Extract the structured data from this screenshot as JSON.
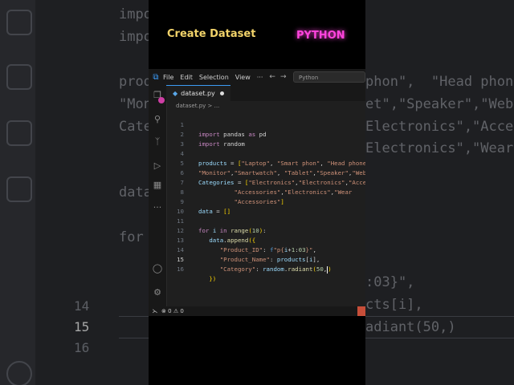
{
  "overlay": {
    "title": "Create Dataset",
    "tag": "PYTHON"
  },
  "menubar": {
    "items": [
      "File",
      "Edit",
      "Selection",
      "View",
      "···"
    ],
    "search_text": "Python"
  },
  "tab": {
    "filename": "dataset.py"
  },
  "breadcrumb": "dataset.py > ...",
  "code": [
    {
      "n": "1",
      "t": "import pandas as pd"
    },
    {
      "n": "2",
      "t": "import random"
    },
    {
      "n": "3",
      "t": ""
    },
    {
      "n": "4",
      "t": "products = [\"Laptop\", \"Smart phon\", \"Head phone"
    },
    {
      "n": "5",
      "t": "\"Monitor\",\"Smartwatch\", \"Tablet\",\"Speaker\",\"Web"
    },
    {
      "n": "6",
      "t": "Categories = [\"Electronics\",\"Electronics\",\"Acce"
    },
    {
      "n": "7",
      "t": "               \"Accessories\",\"Electronics\",\"Wear"
    },
    {
      "n": "8",
      "t": "               \"Accessories\"]"
    },
    {
      "n": "9",
      "t": "data = []"
    },
    {
      "n": "10",
      "t": ""
    },
    {
      "n": "11",
      "t": "for i in range(10):"
    },
    {
      "n": "12",
      "t": "    data.append({"
    },
    {
      "n": "13",
      "t": "        \"Product_ID\": f\"p{i+1:03}\","
    },
    {
      "n": "14",
      "t": "        \"Product_Name\": products[i],"
    },
    {
      "n": "15",
      "t": "        \"Category\": random.radiant(50,)"
    },
    {
      "n": "16",
      "t": "    })"
    }
  ],
  "status": {
    "errors": "0",
    "warnings": "0"
  },
  "background": {
    "code_lines": [
      "impo",
      "impo",
      "produ",
      "\"Mon",
      "Cate",
      "data",
      "for"
    ],
    "right_lines": [
      "phon\",  \"Head phone",
      "et\",\"Speaker\",\"Web",
      "Electronics\",\"Acce",
      "Electronics\",\"Wear",
      ":03}\",",
      "cts[i],",
      "adiant(50,)"
    ],
    "line_numbers": [
      "14",
      "15",
      "16"
    ]
  }
}
